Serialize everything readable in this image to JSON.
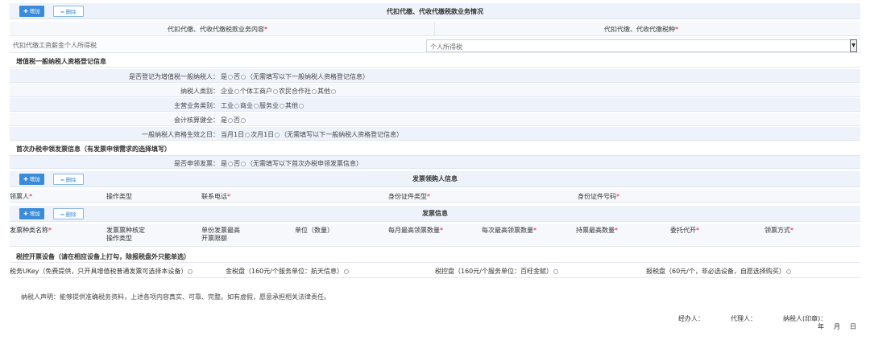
{
  "buttons": {
    "add": "✚ 增加",
    "del": "━ 删除"
  },
  "withholding": {
    "title": "代扣代缴、代收代缴税款业务情况",
    "col1": "代扣代缴、代收代缴税款业务内容",
    "col2": "代扣代缴、代收代缴税种",
    "row_content": "代扣代缴工资薪金个人所得税",
    "row_tax": "个人所得税"
  },
  "vat": {
    "title": "增值税一般纳税人资格登记信息",
    "rows": [
      {
        "label": "是否登记为增值税一般纳税人：",
        "opts": [
          "是",
          "否"
        ],
        "note": "（无需填写以下一般纳税人资格登记信息）"
      },
      {
        "label": "纳税人类别：",
        "opts": [
          "企业",
          "个体工商户",
          "农民合作社",
          "其他"
        ],
        "note": ""
      },
      {
        "label": "主营业务类别：",
        "opts": [
          "工业",
          "商业",
          "服务业",
          "其他"
        ],
        "note": ""
      },
      {
        "label": "会计核算健全：",
        "opts": [
          "是",
          "否"
        ],
        "note": ""
      },
      {
        "label": "一般纳税人资格生效之日：",
        "opts": [
          "当月1日",
          "次月1日"
        ],
        "note": "（无需填写以下一般纳税人资格登记信息）"
      }
    ]
  },
  "first_invoice": {
    "title": "首次办税申领发票信息（有发票申领需求的选择填写）",
    "label": "是否申领发票：",
    "opts": [
      "是",
      "否"
    ],
    "note": "（无需填写以下首次办税申领发票信息）"
  },
  "receiver": {
    "title": "发票领购人信息",
    "cols": [
      "领票人",
      "操作类型",
      "联系电话",
      "身份证件类型",
      "身份证件号码"
    ]
  },
  "invoice": {
    "title": "发票信息",
    "cols": [
      "发票种类名称",
      "发票票种核定\n操作类型",
      "单份发票最高\n开票限额",
      "单位（数量）",
      "每月最高领票数量",
      "每次最高领票数量",
      "持票最高数量",
      "委托代开",
      "领票方式"
    ]
  },
  "device": {
    "title": "税控开票设备（请在相应设备上打勾，除报税盘外只能单选）",
    "items": [
      "税务UKey（免费提供，只开具增值税普通发票可选择本设备）",
      "金税盘（160元/个服务单位：航天信息）",
      "税控盘（160元/个服务单位：百旺金赋）",
      "报税盘（60元/个，非必选设备，自愿选择购买）"
    ]
  },
  "declaration": "纳税人声明：能够提供准确税务资料，上述各项内容真实、可靠、完整。如有虚假，愿意承担相关法律责任。",
  "sign": {
    "handler": "经办人：",
    "agent": "代理人：",
    "taxpayer": "纳税人(印章)：",
    "year": "年",
    "month": "月",
    "day": "日"
  }
}
